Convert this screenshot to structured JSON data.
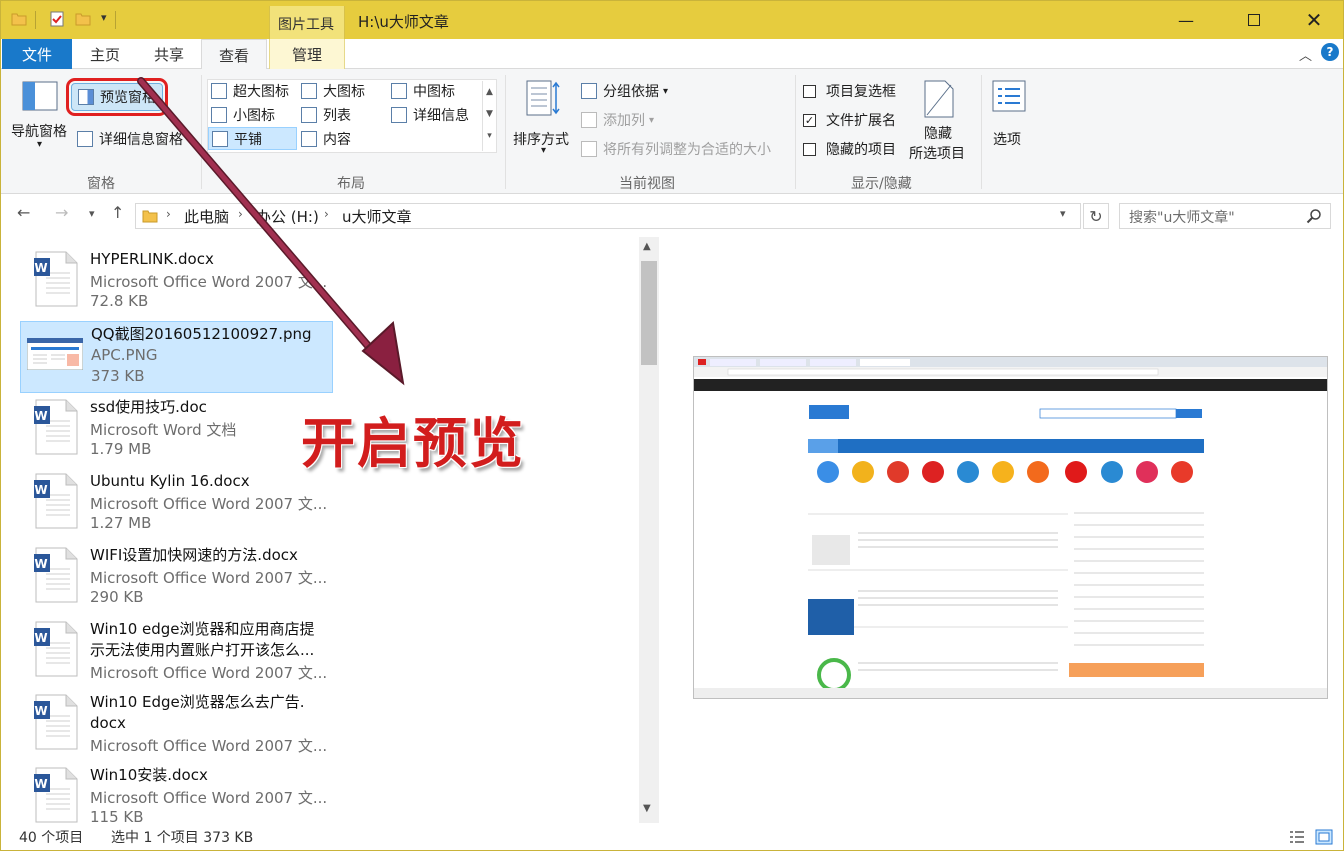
{
  "window": {
    "title": "H:\\u大师文章",
    "contextual_tab_group": "图片工具"
  },
  "tabs": [
    {
      "label": "文件"
    },
    {
      "label": "主页"
    },
    {
      "label": "共享"
    },
    {
      "label": "查看"
    },
    {
      "label": "管理"
    }
  ],
  "ribbon": {
    "panes": {
      "nav_pane": "导航窗格",
      "preview_pane": "预览窗格",
      "details_pane": "详细信息窗格",
      "group_label": "窗格"
    },
    "layout": {
      "items": [
        "超大图标",
        "大图标",
        "中图标",
        "小图标",
        "列表",
        "详细信息",
        "平铺",
        "内容"
      ],
      "selected": "平铺",
      "group_label": "布局"
    },
    "current_view": {
      "sort_by": "排序方式",
      "group_by": "分组依据",
      "add_column": "添加列",
      "fit_columns": "将所有列调整为合适的大小",
      "group_label": "当前视图"
    },
    "show_hide": {
      "item_checkboxes": "项目复选框",
      "item_checkboxes_checked": false,
      "file_extensions": "文件扩展名",
      "file_extensions_checked": true,
      "hidden_items": "隐藏的项目",
      "hidden_items_checked": false,
      "hide_selected_line1": "隐藏",
      "hide_selected_line2": "所选项目",
      "group_label": "显示/隐藏"
    },
    "options": "选项"
  },
  "address": {
    "crumbs": [
      "此电脑",
      "办公 (H:)",
      "u大师文章"
    ],
    "search_placeholder": "搜索\"u大师文章\""
  },
  "files": [
    {
      "name": "HYPERLINK.docx",
      "type": "Microsoft Office Word 2007 文...",
      "size": "72.8 KB",
      "icon": "word-doc-icon"
    },
    {
      "name": "QQ截图20160512100927.png",
      "type": "APC.PNG",
      "size": "373 KB",
      "icon": "image-thumbnail",
      "selected": true
    },
    {
      "name": "ssd使用技巧.doc",
      "type": "Microsoft Word 文档",
      "size": "1.79 MB",
      "icon": "word-doc-icon"
    },
    {
      "name": "Ubuntu Kylin 16.docx",
      "type": "Microsoft Office Word 2007 文...",
      "size": "1.27 MB",
      "icon": "word-doc-icon"
    },
    {
      "name": "WIFI设置加快网速的方法.docx",
      "type": "Microsoft Office Word 2007 文...",
      "size": "290 KB",
      "icon": "word-doc-icon"
    },
    {
      "name_line1": "Win10 edge浏览器和应用商店提",
      "name_line2": "示无法使用内置账户打开该怎么...",
      "type": "Microsoft Office Word 2007 文...",
      "icon": "word-doc-icon"
    },
    {
      "name_line1": "Win10 Edge浏览器怎么去广告.",
      "name_line2": "docx",
      "type": "Microsoft Office Word 2007 文...",
      "icon": "word-doc-icon"
    },
    {
      "name": "Win10安装.docx",
      "type": "Microsoft Office Word 2007 文...",
      "size": "115 KB",
      "icon": "word-doc-icon"
    }
  ],
  "annotation": "开启预览",
  "status": {
    "item_count": "40 个项目",
    "selection": "选中 1 个项目  373 KB"
  },
  "colors": {
    "titlebar": "#e6cc3e",
    "file_tab": "#1979ca",
    "selection": "#cce8ff",
    "annotation_red": "#d21d1d",
    "arrow": "#8a2040"
  }
}
